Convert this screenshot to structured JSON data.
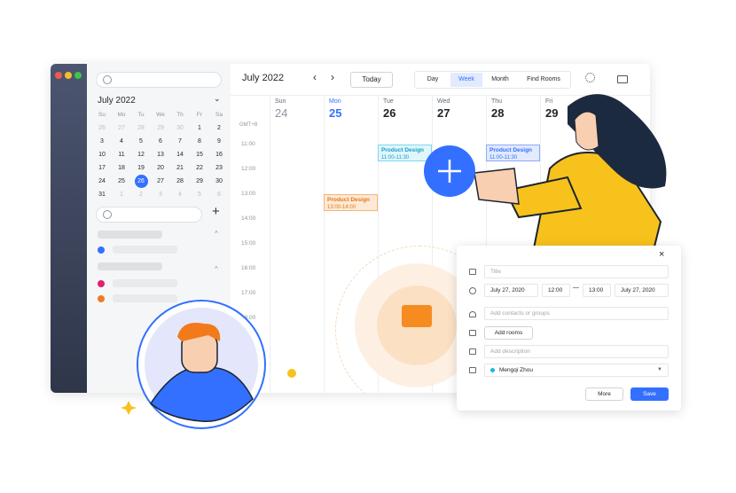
{
  "sidebar": {
    "month_label": "July 2022",
    "weekdays": [
      "Su",
      "Mo",
      "Tu",
      "We",
      "Th",
      "Fr",
      "Sa"
    ],
    "weeks": [
      [
        "26",
        "27",
        "28",
        "29",
        "30",
        "1",
        "2"
      ],
      [
        "3",
        "4",
        "5",
        "6",
        "7",
        "8",
        "9"
      ],
      [
        "10",
        "11",
        "12",
        "13",
        "14",
        "15",
        "16"
      ],
      [
        "17",
        "18",
        "19",
        "20",
        "21",
        "22",
        "23"
      ],
      [
        "24",
        "25",
        "26",
        "27",
        "28",
        "29",
        "30"
      ],
      [
        "31",
        "1",
        "2",
        "3",
        "4",
        "5",
        "6"
      ]
    ],
    "selected_day": "26",
    "calendar_colors": [
      "#3370ff",
      "#e0206f",
      "#f07b24"
    ]
  },
  "header": {
    "title": "July 2022",
    "today": "Today",
    "views": [
      "Day",
      "Week",
      "Month",
      "Find Rooms"
    ],
    "active_view": "Week"
  },
  "grid": {
    "timezone": "GMT+8",
    "days": [
      {
        "name": "Sun",
        "num": "24"
      },
      {
        "name": "Mon",
        "num": "25"
      },
      {
        "name": "Tue",
        "num": "26"
      },
      {
        "name": "Wed",
        "num": "27"
      },
      {
        "name": "Thu",
        "num": "28"
      },
      {
        "name": "Fri",
        "num": "29"
      }
    ],
    "times": [
      "11:00",
      "12:00",
      "13:00",
      "14:00",
      "15:00",
      "16:00",
      "17:00",
      "18:00"
    ],
    "events": [
      {
        "title": "Product Design",
        "time": "11:00-11:30",
        "day": "Tue"
      },
      {
        "title": "Product Design",
        "time": "11:00-11:30",
        "day": "Thu"
      },
      {
        "title": "Product Design",
        "time": "13:00-14:00",
        "day": "Mon"
      }
    ]
  },
  "popup": {
    "title_placeholder": "Title",
    "start_date": "July 27, 2020",
    "start_time": "12:00",
    "end_time": "13:00",
    "end_date": "July 27, 2020",
    "dash": "—",
    "contacts_placeholder": "Add contacts or groups",
    "add_rooms": "Add rooms",
    "description_placeholder": "Add description",
    "calendar_owner": "Mengqi Zhou",
    "more": "More",
    "save": "Save"
  },
  "colors": {
    "accent": "#3370ff",
    "brand_yellow": "#f7c21b",
    "event_orange": "#f5a35c",
    "event_cyan": "#4cc3e0"
  }
}
